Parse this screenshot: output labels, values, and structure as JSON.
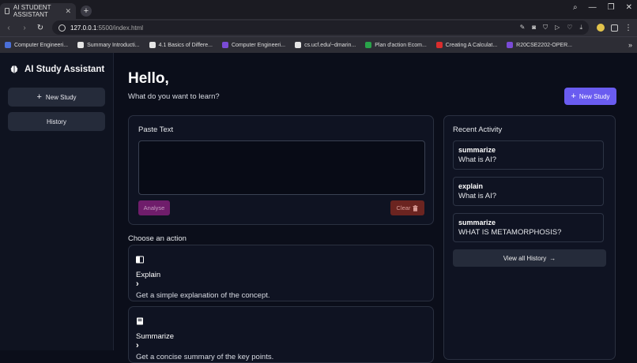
{
  "browser": {
    "tab_title": "AI STUDENT ASSISTANT",
    "url_host": "127.0.0.1",
    "url_path": ":5500/index.html",
    "bookmarks": [
      "Computer Engineeri...",
      "Summary Introducti...",
      "4.1 Basics of Differe...",
      "Computer Engineeri...",
      "cs.ucf.edu/~dmarin...",
      "Plan d'action Ecom...",
      "Creating A Calculat...",
      "R20CSE2202-OPER..."
    ]
  },
  "sidebar": {
    "brand": "AI Study Assistant",
    "new_study": "New Study",
    "history": "History"
  },
  "main": {
    "greeting": "Hello,",
    "subtitle": "What do you want to learn?",
    "new_study": "New Study",
    "paste_title": "Paste Text",
    "paste_value": "",
    "analyse": "Analyse",
    "clear": "Clear",
    "choose_label": "Choose an action",
    "actions": [
      {
        "name": "Explain",
        "desc": "Get a simple explanation of the concept."
      },
      {
        "name": "Summarize",
        "desc": "Get a concise summary of the key points."
      }
    ]
  },
  "recent": {
    "title": "Recent Activity",
    "items": [
      {
        "action": "summarize",
        "query": "What is AI?"
      },
      {
        "action": "explain",
        "query": "What is AI?"
      },
      {
        "action": "summarize",
        "query": "WHAT IS METAMORPHOSIS?"
      }
    ],
    "view_all": "View all History"
  },
  "colors": {
    "accent": "#6a5cf0",
    "analyse_bg": "#6f1d6b",
    "clear_bg": "#6b2420",
    "background": "#0b0e1a"
  }
}
